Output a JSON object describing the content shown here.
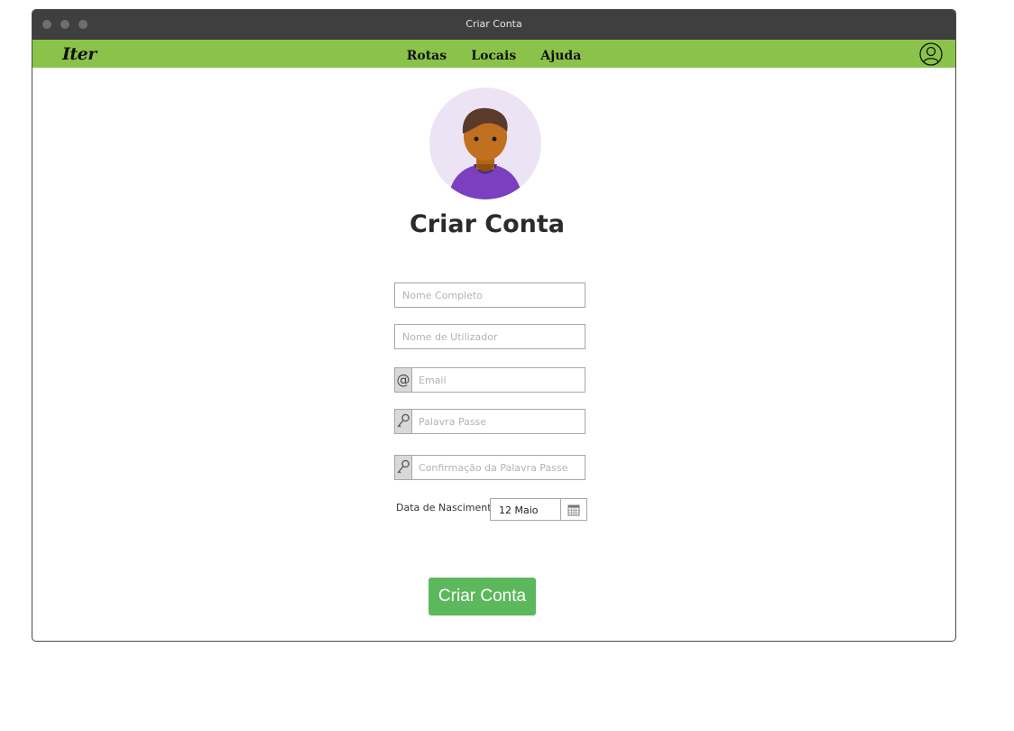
{
  "window": {
    "title": "Criar Conta"
  },
  "navbar": {
    "logo": "Iter",
    "links": [
      "Rotas",
      "Locais",
      "Ajuda"
    ],
    "user_icon": "user-circle-icon",
    "color": "#8bc34a"
  },
  "page": {
    "avatar_icon": "person-avatar-icon",
    "heading": "Criar Conta"
  },
  "form": {
    "full_name": {
      "placeholder": "Nome Completo",
      "value": ""
    },
    "username": {
      "placeholder": "Nome de Utilizador",
      "value": ""
    },
    "email": {
      "placeholder": "Email",
      "value": "",
      "icon": "at-icon"
    },
    "password": {
      "placeholder": "Palavra Passe",
      "value": "",
      "icon": "key-icon"
    },
    "password_confirm": {
      "placeholder": "Confirmação da Palavra Passe",
      "value": "",
      "icon": "key-icon"
    },
    "dob_label": "Data de Nascimento",
    "dob_value": "12 Maio",
    "dob_icon": "calendar-icon",
    "submit_label": "Criar Conta",
    "submit_color": "#5cb85c"
  }
}
